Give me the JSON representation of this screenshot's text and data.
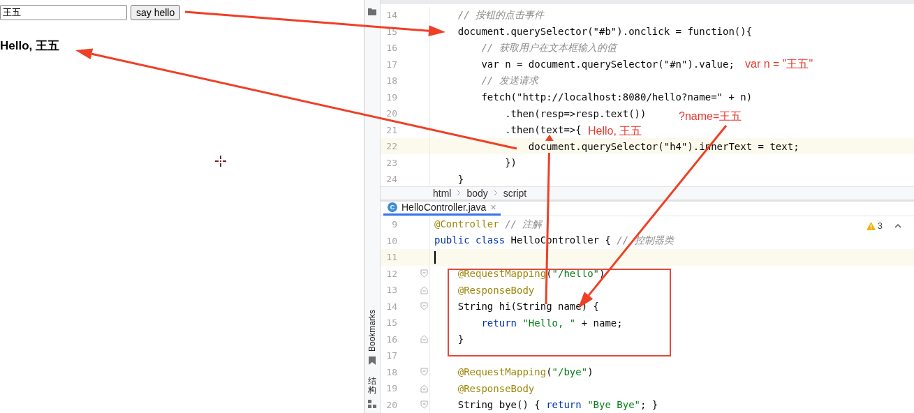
{
  "browser": {
    "name_field": {
      "value": "王五"
    },
    "button": {
      "label": "say hello"
    },
    "heading": "Hello, 王五"
  },
  "tool_strip": {
    "bookmarks_label": "Bookmarks",
    "structure_label": "结构"
  },
  "top_editor": {
    "lines": [
      {
        "number": "14",
        "tokens": [
          {
            "kind": "comment",
            "text": "// 按钮的点击事件"
          }
        ],
        "current": false
      },
      {
        "number": "15",
        "tokens": [
          {
            "kind": "plain",
            "text": "document.querySelector(\"#b\").onclick = function(){"
          }
        ],
        "current": false
      },
      {
        "number": "16",
        "tokens": [
          {
            "kind": "comment",
            "text": "// 获取用户在文本框输入的值"
          }
        ],
        "current": false
      },
      {
        "number": "17",
        "tokens": [
          {
            "kind": "plain",
            "text": "var n = document.querySelector(\"#n\").value;"
          }
        ],
        "current": false
      },
      {
        "number": "18",
        "tokens": [
          {
            "kind": "comment",
            "text": "// 发送请求"
          }
        ],
        "current": false
      },
      {
        "number": "19",
        "tokens": [
          {
            "kind": "plain",
            "text": "fetch(\"http://localhost:8080/hello?name=\" + n)"
          }
        ],
        "current": false
      },
      {
        "number": "20",
        "tokens": [
          {
            "kind": "plain",
            "text": ".then(resp=>resp.text())"
          }
        ],
        "current": false
      },
      {
        "number": "21",
        "tokens": [
          {
            "kind": "plain",
            "text": ".then(text=>{"
          }
        ],
        "current": false
      },
      {
        "number": "22",
        "tokens": [
          {
            "kind": "plain",
            "text": "document.querySelector(\"h4\").innerText = text;"
          }
        ],
        "current": true
      },
      {
        "number": "23",
        "tokens": [
          {
            "kind": "plain",
            "text": "})"
          }
        ],
        "current": false
      },
      {
        "number": "24",
        "tokens": [
          {
            "kind": "plain",
            "text": "}"
          }
        ],
        "current": false
      }
    ]
  },
  "breadcrumbs": [
    "html",
    "body",
    "script"
  ],
  "tab": {
    "icon_letter": "C",
    "title": "HelloController.java",
    "close": "×",
    "selected": true
  },
  "inspection": {
    "warnings": "3"
  },
  "bottom_editor": {
    "lines": [
      {
        "number": "9",
        "tokens": [
          {
            "kind": "annotation",
            "text": "@Controller"
          },
          {
            "kind": "comment",
            "text": " // 注解"
          }
        ],
        "current": false
      },
      {
        "number": "10",
        "tokens": [
          {
            "kind": "keyword",
            "text": "public class"
          },
          {
            "kind": "plain",
            "text": " HelloController { "
          },
          {
            "kind": "comment",
            "text": "// 控制器类"
          }
        ],
        "current": false
      },
      {
        "number": "11",
        "current": true,
        "caret": true
      },
      {
        "number": "12",
        "tokens": [
          {
            "kind": "annotation",
            "text": "@RequestMapping"
          },
          {
            "kind": "plain",
            "text": "("
          },
          {
            "kind": "string",
            "text": "\"/hello\""
          },
          {
            "kind": "plain",
            "text": ")"
          }
        ],
        "current": false,
        "fold_start": true
      },
      {
        "number": "13",
        "tokens": [
          {
            "kind": "annotation",
            "text": "@ResponseBody"
          }
        ],
        "current": false,
        "fold_end": true
      },
      {
        "number": "14",
        "tokens": [
          {
            "kind": "plain",
            "text": "String hi(String name) {"
          }
        ],
        "current": false,
        "fold_start": true
      },
      {
        "number": "15",
        "tokens": [
          {
            "kind": "keyword",
            "text": "return"
          },
          {
            "kind": "string",
            "text": " \"Hello, \""
          },
          {
            "kind": "plain",
            "text": " + name;"
          }
        ],
        "current": false
      },
      {
        "number": "16",
        "tokens": [
          {
            "kind": "plain",
            "text": "}"
          }
        ],
        "current": false,
        "fold_end": true
      },
      {
        "number": "17",
        "current": false
      },
      {
        "number": "18",
        "tokens": [
          {
            "kind": "annotation",
            "text": "@RequestMapping"
          },
          {
            "kind": "plain",
            "text": "("
          },
          {
            "kind": "string",
            "text": "\"/bye\""
          },
          {
            "kind": "plain",
            "text": ")"
          }
        ],
        "current": false,
        "fold_start": true
      },
      {
        "number": "19",
        "tokens": [
          {
            "kind": "annotation",
            "text": "@ResponseBody"
          }
        ],
        "current": false,
        "fold_end": true
      },
      {
        "number": "20",
        "tokens": [
          {
            "kind": "plain",
            "text": "String bye() { "
          },
          {
            "kind": "keyword",
            "text": "return"
          },
          {
            "kind": "string",
            "text": " \"Bye Bye\""
          },
          {
            "kind": "plain",
            "text": "; }"
          }
        ],
        "current": false,
        "fold_start": true
      }
    ]
  },
  "annotations": {
    "notes": [
      "var n = \"王五\"",
      "?name=王五",
      "Hello, 王五"
    ]
  }
}
